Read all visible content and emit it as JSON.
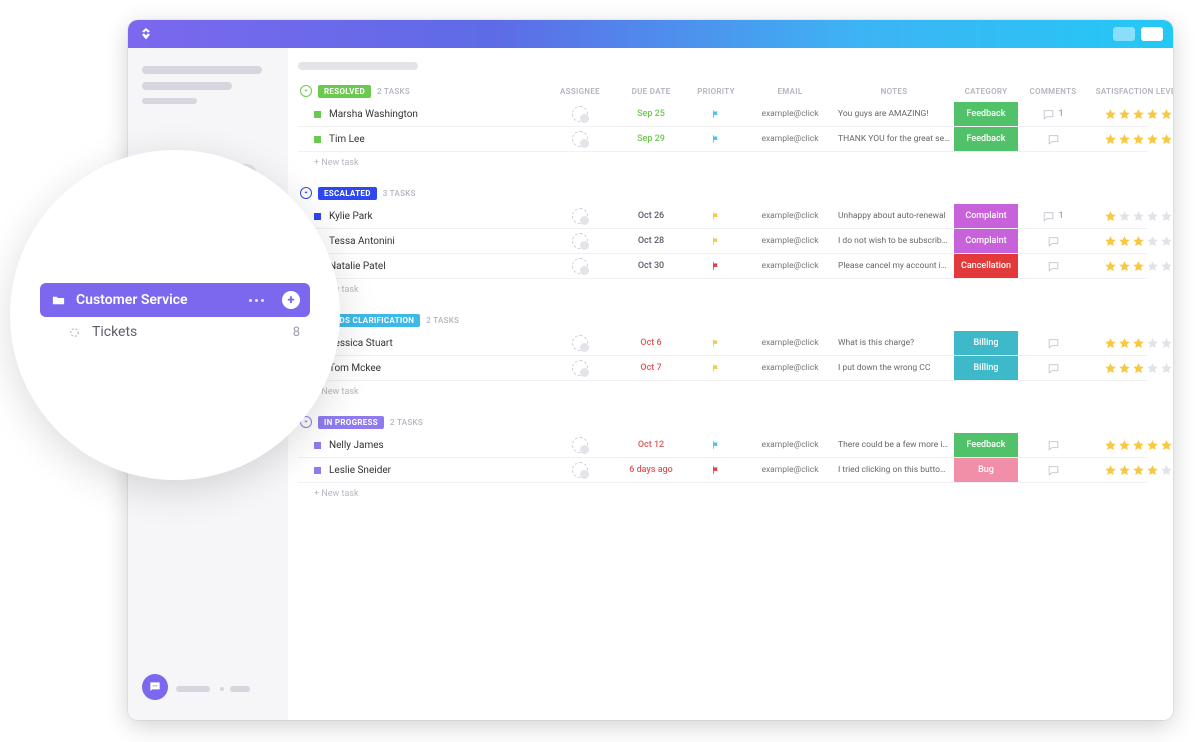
{
  "sidebar_preview": {
    "folder_label": "Customer Service",
    "list_label": "Tickets",
    "list_count": "8"
  },
  "columns": {
    "assignee": "ASSIGNEE",
    "due_date": "DUE DATE",
    "priority": "PRIORITY",
    "email": "EMAIL",
    "notes": "NOTES",
    "category": "CATEGORY",
    "comments": "COMMENTS",
    "satisfaction": "SATISFACTION LEVEL"
  },
  "new_task_label": "+ New task",
  "groups": [
    {
      "status": "RESOLVED",
      "status_color": "#6BC950",
      "task_count": "2 TASKS",
      "show_headers": true,
      "rows": [
        {
          "name": "Marsha Washington",
          "due": "Sep 25",
          "due_color": "#6BC950",
          "priority_color": "#45C4EB",
          "email": "example@click",
          "note": "You guys are AMAZING!",
          "category": "Feedback",
          "category_color": "#52C26A",
          "comments": "1",
          "stars": 5
        },
        {
          "name": "Tim Lee",
          "due": "Sep 29",
          "due_color": "#6BC950",
          "priority_color": "#45C4EB",
          "email": "example@click",
          "note": "THANK YOU for the great se…",
          "category": "Feedback",
          "category_color": "#52C26A",
          "comments": "",
          "stars": 5
        }
      ]
    },
    {
      "status": "ESCALATED",
      "status_color": "#2F47EE",
      "task_count": "3 TASKS",
      "show_headers": false,
      "rows": [
        {
          "name": "Kylie Park",
          "due": "Oct 26",
          "due_color": "#5b5d6b",
          "priority_color": "#F7C844",
          "email": "example@click",
          "note": "Unhappy about auto-renewal",
          "category": "Complaint",
          "category_color": "#C762DB",
          "comments": "1",
          "stars": 1
        },
        {
          "name": "Tessa Antonini",
          "due": "Oct 28",
          "due_color": "#5b5d6b",
          "priority_color": "#F7C844",
          "email": "example@click",
          "note": "I do not wish to be subscribe…",
          "category": "Complaint",
          "category_color": "#C762DB",
          "comments": "",
          "stars": 3
        },
        {
          "name": "Natalie Patel",
          "due": "Oct 30",
          "due_color": "#5b5d6b",
          "priority_color": "#E23A3A",
          "email": "example@click",
          "note": "Please cancel my account im…",
          "category": "Cancellation",
          "category_color": "#E23A3A",
          "comments": "",
          "stars": 3
        }
      ]
    },
    {
      "status": "NEEDS CLARIFICATION",
      "status_color": "#3DB9E8",
      "task_count": "2 TASKS",
      "show_headers": false,
      "rows": [
        {
          "name": "Jessica Stuart",
          "due": "Oct 6",
          "due_color": "#E05757",
          "priority_color": "#F7C844",
          "email": "example@click",
          "note": "What is this charge?",
          "category": "Billing",
          "category_color": "#3DB9C9",
          "comments": "",
          "stars": 3
        },
        {
          "name": "Tom Mckee",
          "due": "Oct 7",
          "due_color": "#E05757",
          "priority_color": "#F7C844",
          "email": "example@click",
          "note": "I put down the wrong CC",
          "category": "Billing",
          "category_color": "#3DB9C9",
          "comments": "",
          "stars": 3
        }
      ]
    },
    {
      "status": "IN PROGRESS",
      "status_color": "#8F7BEF",
      "task_count": "2 TASKS",
      "show_headers": false,
      "rows": [
        {
          "name": "Nelly James",
          "due": "Oct 12",
          "due_color": "#E05757",
          "priority_color": "#45C4EB",
          "email": "example@click",
          "note": "There could be a few more i…",
          "category": "Feedback",
          "category_color": "#52C26A",
          "comments": "",
          "stars": 5
        },
        {
          "name": "Leslie Sneider",
          "due": "6 days ago",
          "due_color": "#E05757",
          "priority_color": "#E23A3A",
          "email": "example@click",
          "note": "I tried clicking on this button…",
          "category": "Bug",
          "category_color": "#F08FA7",
          "comments": "",
          "stars": 4
        }
      ]
    }
  ]
}
